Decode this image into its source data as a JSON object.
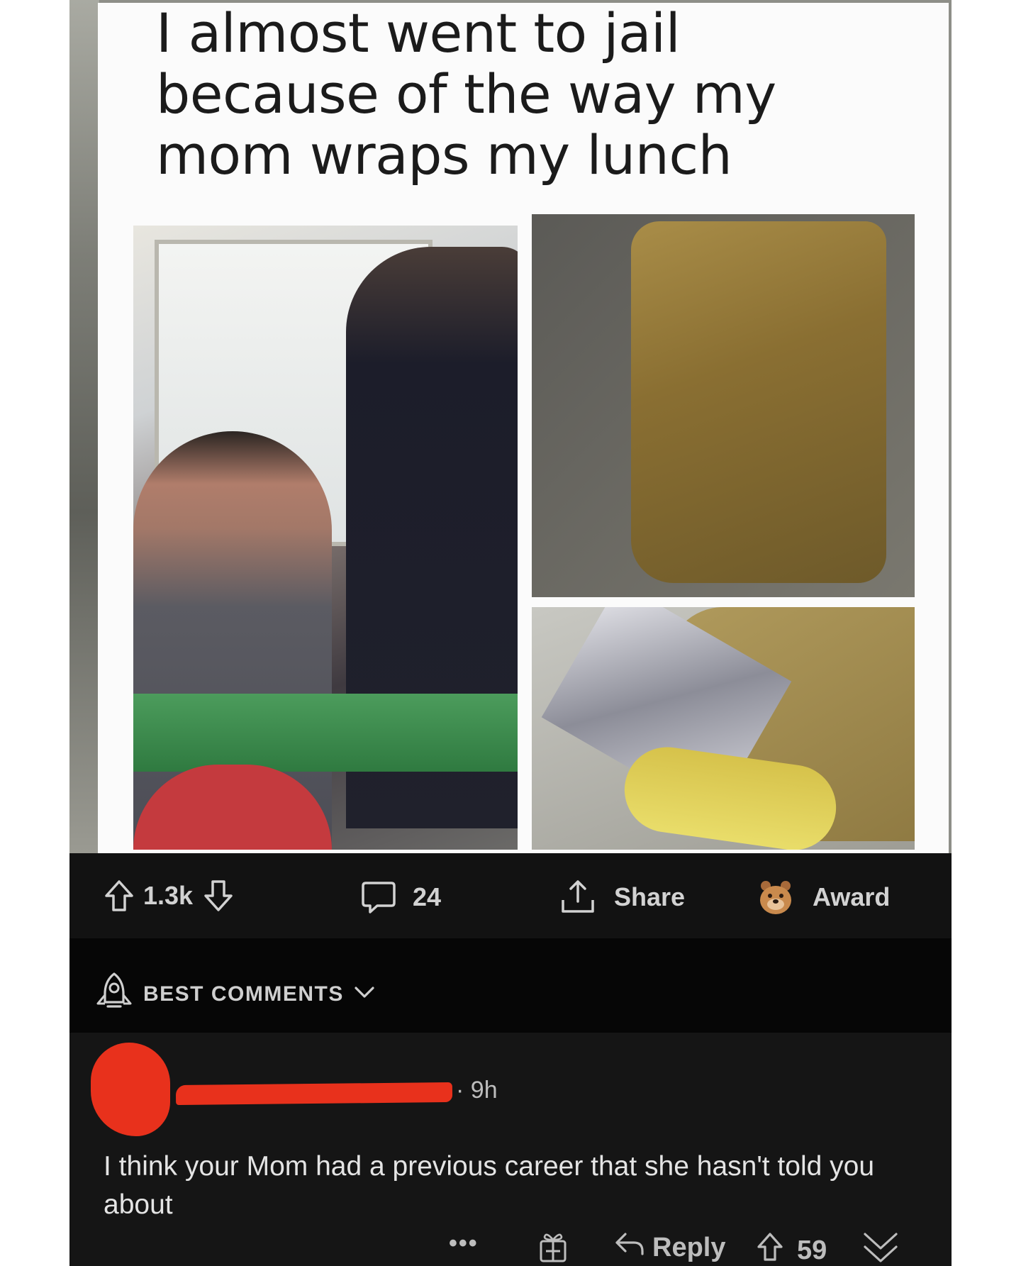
{
  "post": {
    "title": "I almost went to jail because of the way my mom wraps my lunch"
  },
  "actions": {
    "upvotes": "1.3k",
    "comments": "24",
    "share_label": "Share",
    "award_label": "Award"
  },
  "sort": {
    "label": "BEST COMMENTS"
  },
  "comment": {
    "time": "9h",
    "text": "I think your Mom had a previous career that she hasn't told you about",
    "more_label": "•••",
    "reply_label": "Reply",
    "votes": "59"
  },
  "colors": {
    "background": "#131313",
    "redaction": "#e8311c",
    "text": "#e4e4e4",
    "icon": "#d2d2d2"
  },
  "icons": [
    "upvote-icon",
    "downvote-icon",
    "comment-icon",
    "share-icon",
    "award-icon",
    "rocket-icon",
    "chevron-down-icon",
    "gift-icon",
    "reply-icon",
    "collapse-icon"
  ]
}
